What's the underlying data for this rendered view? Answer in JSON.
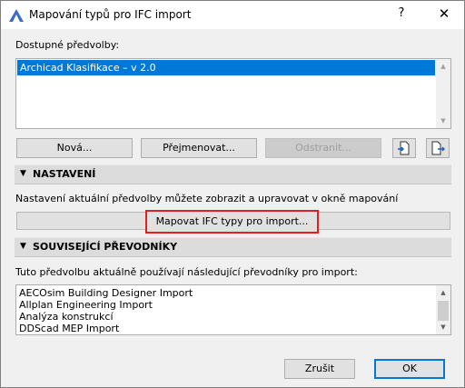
{
  "window": {
    "title": "Mapování typů pro IFC import",
    "help": "?",
    "close": "✕"
  },
  "presets": {
    "label": "Dostupné předvolby:",
    "items": [
      "Archicad Klasifikace – v 2.0"
    ]
  },
  "buttons": {
    "new": "Nová...",
    "rename": "Přejmenovat...",
    "remove": "Odstranit..."
  },
  "settings": {
    "title": "NASTAVENÍ",
    "description": "Nastavení aktuální předvolby můžete zobrazit a upravovat v okně mapování",
    "map_button": "Mapovat IFC typy pro import..."
  },
  "translators": {
    "title": "SOUVISEJÍCÍ PŘEVODNÍKY",
    "description": "Tuto předvolbu aktuálně používají následující převodníky pro import:",
    "items": [
      "AECOsim Building Designer Import",
      "Allplan Engineering Import",
      "Analýza konstrukcí",
      "DDScad MEP Import"
    ]
  },
  "footer": {
    "cancel": "Zrušit",
    "ok": "OK"
  },
  "icons": {
    "app": "archicad-app-icon",
    "import": "import-preset-icon",
    "export": "export-preset-icon",
    "collapse": "triangle-down-icon"
  },
  "colors": {
    "selection": "#0078d7",
    "highlight_frame": "#e02020"
  }
}
